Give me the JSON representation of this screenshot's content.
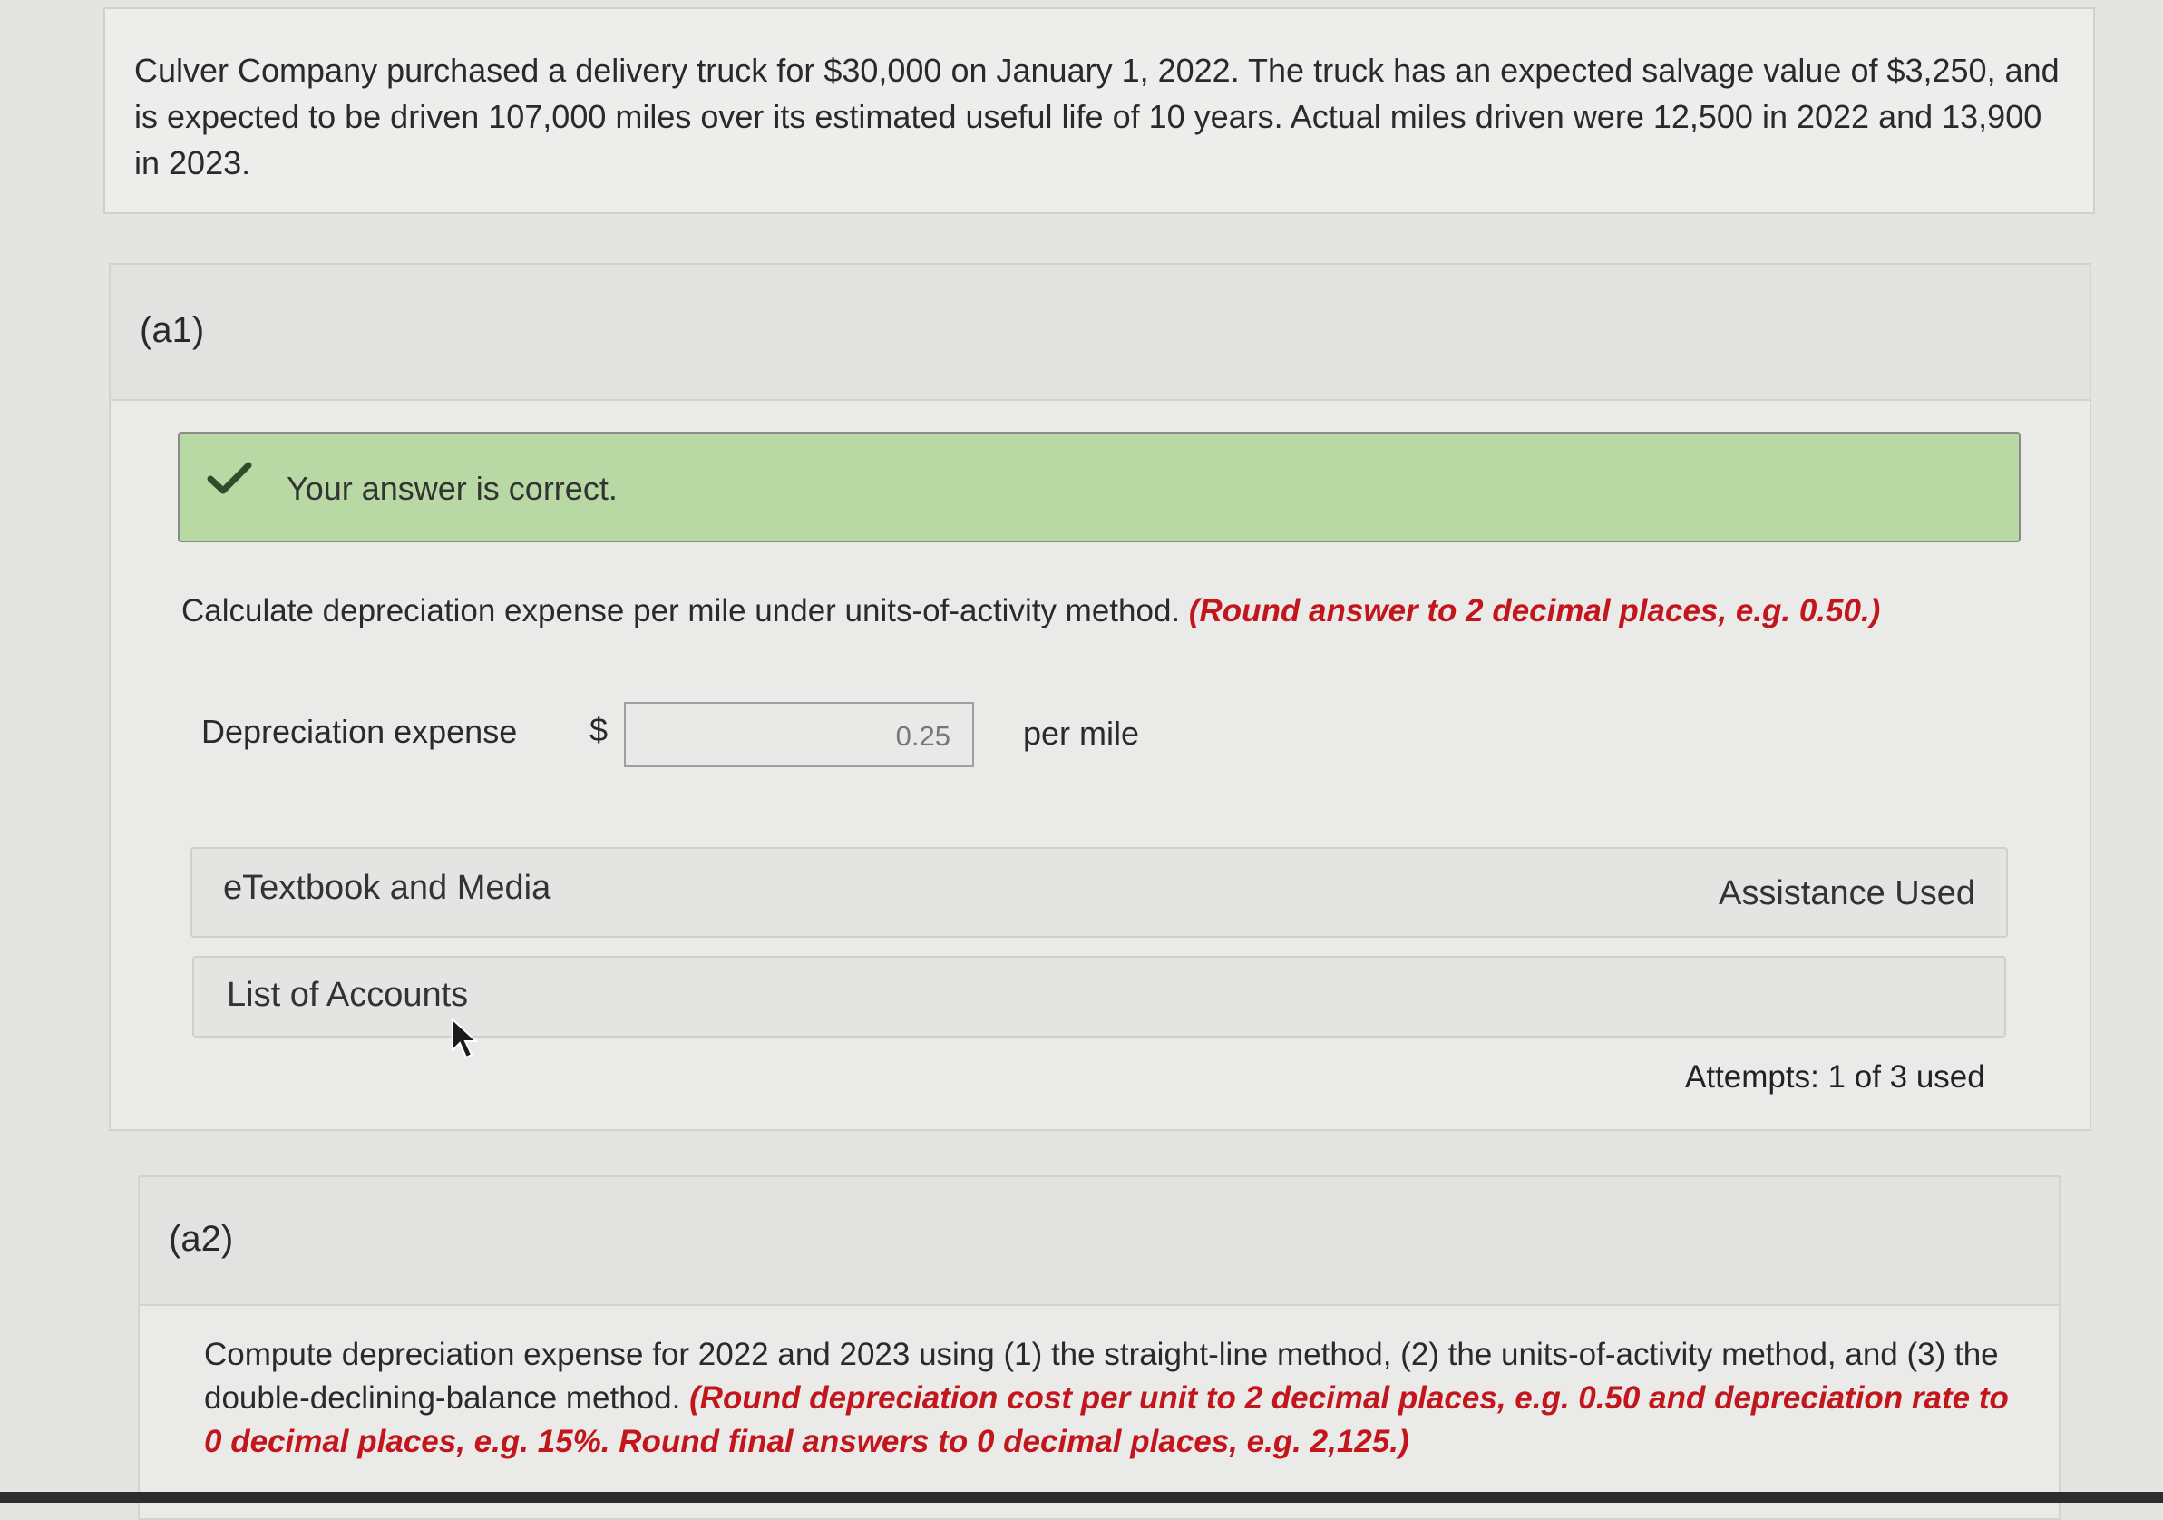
{
  "problem": {
    "text": "Culver Company purchased a delivery truck for $30,000 on January 1, 2022. The truck has an expected salvage value of $3,250, and is expected to be driven 107,000 miles over its estimated useful life of 10 years. Actual miles driven were 12,500 in 2022 and 13,900 in 2023."
  },
  "part_a1": {
    "label": "(a1)",
    "feedback": "Your answer is correct.",
    "instruction": "Calculate depreciation expense per mile under units-of-activity method.",
    "instruction_note": "(Round answer to 2 decimal places, e.g. 0.50.)",
    "row_label": "Depreciation expense",
    "currency": "$",
    "answer": "0.25",
    "unit": "per mile",
    "etextbook": "eTextbook and Media",
    "assistance": "Assistance Used",
    "accounts": "List of Accounts",
    "attempts": "Attempts: 1 of 3 used"
  },
  "part_a2": {
    "label": "(a2)",
    "instruction": "Compute depreciation expense for 2022 and 2023 using (1) the straight-line method, (2) the units-of-activity method, and (3) the double-declining-balance method.",
    "instruction_note": "(Round depreciation cost per unit to 2 decimal places, e.g. 0.50 and depreciation rate to 0 decimal places, e.g. 15%. Round final answers to 0 decimal places, e.g. 2,125.)"
  },
  "colors": {
    "success_bg": "#b9d9a4",
    "check": "#2e4d2a",
    "note_red": "#c3161c"
  },
  "icons": {
    "check": "check-icon",
    "cursor": "mouse-cursor-icon"
  }
}
